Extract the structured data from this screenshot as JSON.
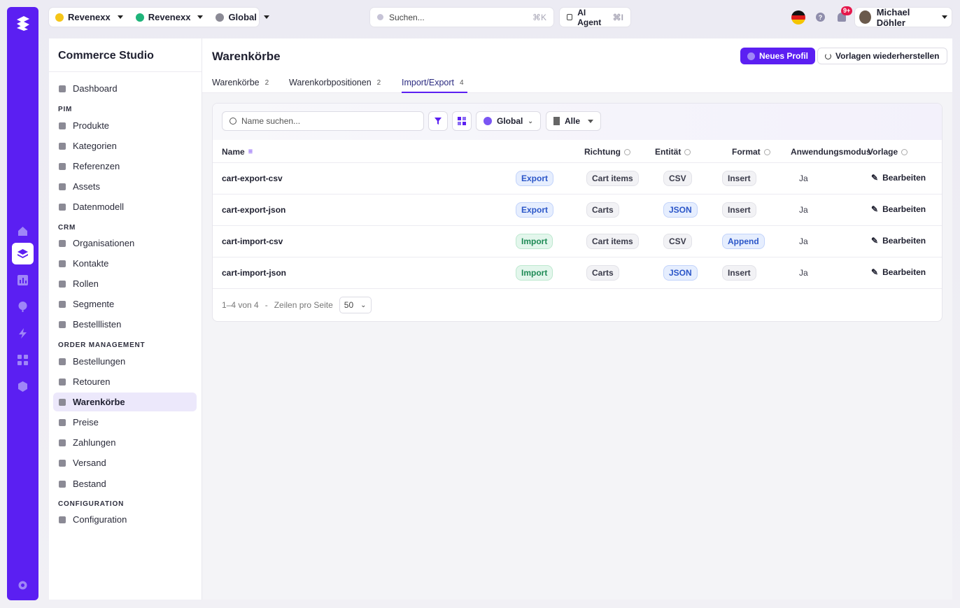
{
  "topbar": {
    "org": "Revenexx",
    "project": "Revenexx",
    "scope": "Global",
    "search_placeholder": "Suchen...",
    "search_shortcut": "⌘K",
    "ai_agent": "AI Agent",
    "ai_shortcut": "⌘I",
    "notifications_badge": "9+",
    "user_name": "Michael Döhler"
  },
  "sidebar": {
    "title": "Commerce Studio",
    "dashboard": "Dashboard",
    "sections": [
      {
        "title": "PIM",
        "items": [
          "Produkte",
          "Kategorien",
          "Referenzen",
          "Assets",
          "Datenmodell"
        ]
      },
      {
        "title": "CRM",
        "items": [
          "Organisationen",
          "Kontakte",
          "Rollen",
          "Segmente",
          "Bestelllisten"
        ]
      },
      {
        "title": "ORDER MANAGEMENT",
        "items": [
          "Bestellungen",
          "Retouren",
          "Warenkörbe",
          "Preise",
          "Zahlungen",
          "Versand",
          "Bestand"
        ]
      },
      {
        "title": "CONFIGURATION",
        "items": [
          "Configuration"
        ]
      }
    ]
  },
  "main": {
    "title": "Warenkörbe",
    "new_profile": "Neues Profil",
    "restore_templates": "Vorlagen wiederherstellen",
    "tabs": [
      {
        "label": "Warenkörbe",
        "count": "2"
      },
      {
        "label": "Warenkorbpositionen",
        "count": "2"
      },
      {
        "label": "Import/Export",
        "count": "4"
      }
    ],
    "filter": {
      "search_placeholder": "Name suchen...",
      "scope": "Global",
      "status": "Alle"
    },
    "columns": [
      "Name",
      "Richtung",
      "Entität",
      "Format",
      "Anwendungsmodus",
      "Vorlage"
    ],
    "rows": [
      {
        "name": "cart-export-csv",
        "direction": "Export",
        "entity": "Cart items",
        "format": "CSV",
        "mode": "Insert",
        "template": "Ja",
        "action": "Bearbeiten"
      },
      {
        "name": "cart-export-json",
        "direction": "Export",
        "entity": "Carts",
        "format": "JSON",
        "mode": "Insert",
        "template": "Ja",
        "action": "Bearbeiten"
      },
      {
        "name": "cart-import-csv",
        "direction": "Import",
        "entity": "Cart items",
        "format": "CSV",
        "mode": "Append",
        "template": "Ja",
        "action": "Bearbeiten"
      },
      {
        "name": "cart-import-json",
        "direction": "Import",
        "entity": "Carts",
        "format": "JSON",
        "mode": "Insert",
        "template": "Ja",
        "action": "Bearbeiten"
      }
    ],
    "pagination": {
      "range": "1–4 von 4",
      "separator": "-",
      "rows_label": "Zeilen pro Seite",
      "rows_value": "50"
    }
  },
  "colors": {
    "accent": "#5b1ff2",
    "rail": "#5b1ff2",
    "export_badge": "#2b56c8",
    "import_badge": "#1e8a55"
  }
}
